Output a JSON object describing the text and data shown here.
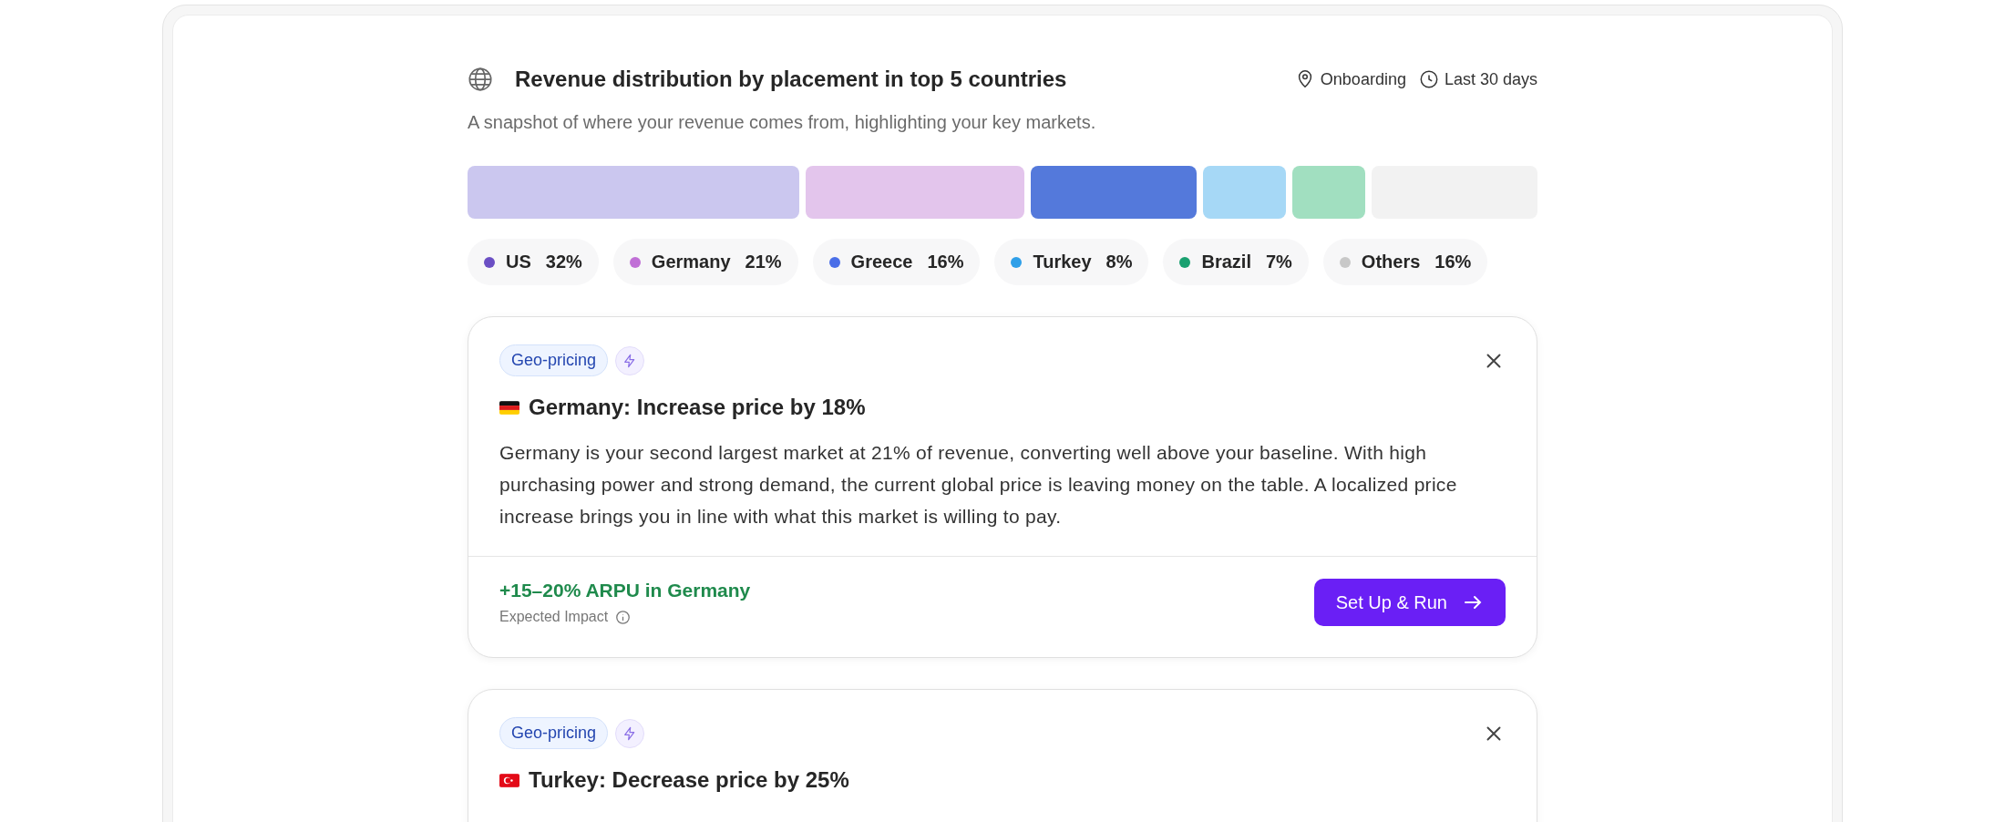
{
  "header": {
    "title": "Revenue distribution by placement in top 5 countries",
    "filters": [
      "Onboarding",
      "Last 30 days"
    ],
    "subtitle": "A snapshot of where your revenue comes from, highlighting your key markets."
  },
  "distribution": {
    "bar_segments": [
      {
        "color": "#cbc7ef"
      },
      {
        "color": "#e3c5ec"
      },
      {
        "color": "#5479db"
      },
      {
        "color": "#a6d8f6"
      },
      {
        "color": "#a1dfc0"
      },
      {
        "color": "#f2f2f2"
      }
    ],
    "legend": [
      {
        "label": "US",
        "share": "32%",
        "color": "#6b4fc4"
      },
      {
        "label": "Germany",
        "share": "21%",
        "color": "#c06fd6"
      },
      {
        "label": "Greece",
        "share": "16%",
        "color": "#4a6ee8"
      },
      {
        "label": "Turkey",
        "share": "8%",
        "color": "#2f9fe8"
      },
      {
        "label": "Brazil",
        "share": "7%",
        "color": "#1aa070"
      },
      {
        "label": "Others",
        "share": "16%",
        "color": "#c8c8c8"
      }
    ]
  },
  "cards": [
    {
      "tag": "Geo-pricing",
      "kind": "de",
      "title": "Germany: Increase price by 18%",
      "body": "Germany is your second largest market at 21% of revenue, converting well above your baseline. With high purchasing power and strong demand, the current global price is leaving money on the table. A localized price increase brings you in line with what this market is willing to pay.",
      "impact": "+15–20% ARPU in Germany",
      "impact_label": "Expected Impact",
      "action": "Set Up & Run"
    },
    {
      "tag": "Geo-pricing",
      "kind": "tr",
      "title": "Turkey: Decrease price by 25%"
    }
  ]
}
